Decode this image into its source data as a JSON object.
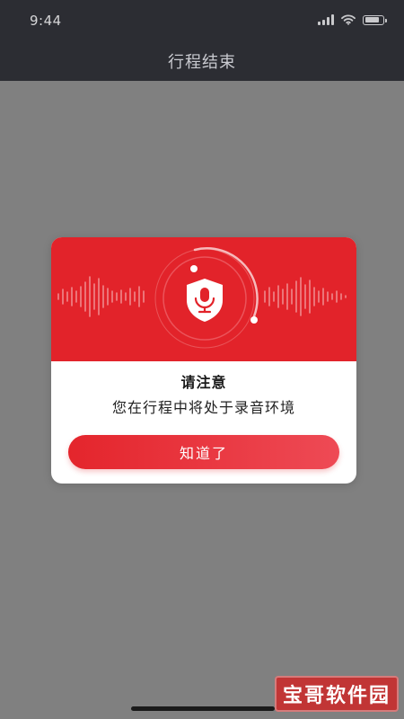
{
  "status_bar": {
    "time": "9:44",
    "icons": [
      "signal-icon",
      "wifi-icon",
      "battery-icon"
    ]
  },
  "nav": {
    "title": "行程结束"
  },
  "dialog": {
    "header_icon": "microphone-shield-icon",
    "title": "请注意",
    "message": "您在行程中将处于录音环境",
    "confirm_label": "知道了"
  },
  "watermark": {
    "text": "宝哥软件园"
  },
  "colors": {
    "status_bar_bg": "#2c2d33",
    "overlay_bg": "#808080",
    "accent_red": "#e2232a",
    "dialog_bg": "#ffffff"
  }
}
